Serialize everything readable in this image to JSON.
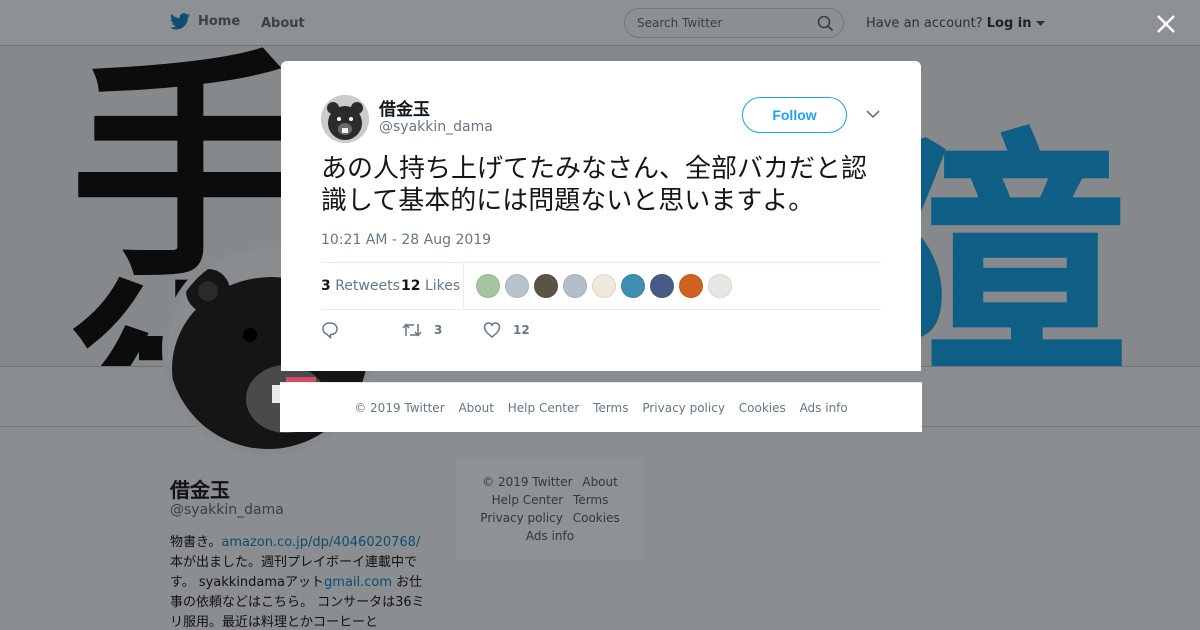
{
  "topbar": {
    "home_label": "Home",
    "about_label": "About",
    "search_placeholder": "Search Twitter",
    "account_prompt": "Have an account?",
    "login_label": "Log in"
  },
  "banner": {
    "left_chars": [
      "手",
      "術"
    ],
    "right_chars": [
      "障"
    ]
  },
  "profile": {
    "name": "借金玉",
    "handle": "@syakkin_dama",
    "bio_text_1": "物書き。",
    "bio_link_1": "amazon.co.jp/dp/4046020768/",
    "bio_text_2": "本が出ました。週刊プレイボーイ連載中です。 syakkindamaアット",
    "bio_link_2": "gmail.com",
    "bio_text_3": " お仕事の依頼などはこちら。 コンサータは36ミリ服用。最近は料理とかコーヒーと"
  },
  "side_footer": {
    "items": [
      "© 2019 Twitter",
      "About",
      "Help Center",
      "Terms",
      "Privacy policy",
      "Cookies",
      "Ads info"
    ]
  },
  "tweet": {
    "author_name": "借金玉",
    "author_handle": "@syakkin_dama",
    "follow_label": "Follow",
    "text": "あの人持ち上げてたみなさん、全部バカだと認識して基本的には問題ないと思いますよ。",
    "timestamp": "10:21 AM - 28 Aug 2019",
    "retweets_count": "3",
    "retweets_label": "Retweets",
    "likes_count": "12",
    "likes_label": "Likes",
    "liker_colors": [
      "#a7c4a0",
      "#b9c3cc",
      "#5b5346",
      "#b3bec8",
      "#efe9dc",
      "#3f8fb5",
      "#4a5a86",
      "#d0621f",
      "#e8e6e3"
    ],
    "action_retweet_count": "3",
    "action_like_count": "12"
  },
  "modal_footer": {
    "items": [
      "© 2019 Twitter",
      "About",
      "Help Center",
      "Terms",
      "Privacy policy",
      "Cookies",
      "Ads info"
    ]
  },
  "colors": {
    "twitter_blue": "#1da1f2",
    "muted_text": "#657786",
    "overlay_bg": "#8a8e91"
  }
}
